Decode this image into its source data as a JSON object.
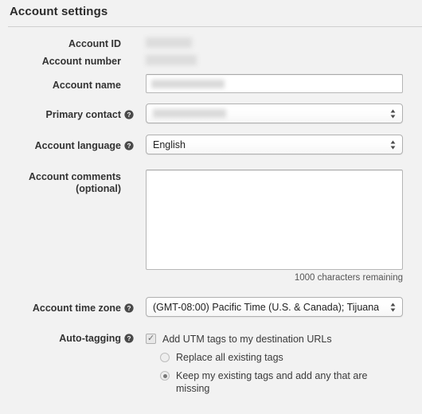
{
  "header": {
    "title": "Account settings"
  },
  "fields": {
    "account_id": {
      "label": "Account ID",
      "value_redacted": true
    },
    "account_number": {
      "label": "Account number",
      "value_redacted": true
    },
    "account_name": {
      "label": "Account name",
      "value": "",
      "value_redacted": true
    },
    "primary_contact": {
      "label": "Primary contact",
      "value": "",
      "value_redacted": true,
      "help_icon": "help-question-icon"
    },
    "account_language": {
      "label": "Account language",
      "value": "English",
      "help_icon": "help-question-icon"
    },
    "account_comments": {
      "label": "Account comments",
      "label_sub": "(optional)",
      "value": "",
      "char_count": "1000 characters remaining"
    },
    "account_time_zone": {
      "label": "Account time zone",
      "value": "(GMT-08:00) Pacific Time (U.S. & Canada); Tijuana",
      "help_icon": "help-question-icon"
    },
    "auto_tagging": {
      "label": "Auto-tagging",
      "help_icon": "help-question-icon",
      "checkbox_label": "Add UTM tags to my destination URLs",
      "checkbox_checked": true,
      "options": [
        {
          "label": "Replace all existing tags",
          "selected": false
        },
        {
          "label": "Keep my existing tags and add any that are missing",
          "selected": true
        }
      ]
    }
  },
  "colors": {
    "background": "#f2f2f2",
    "label_text": "#333333",
    "field_border": "#b0b0b0",
    "divider": "#cfcfcf",
    "redaction": "#dcdcdc"
  }
}
